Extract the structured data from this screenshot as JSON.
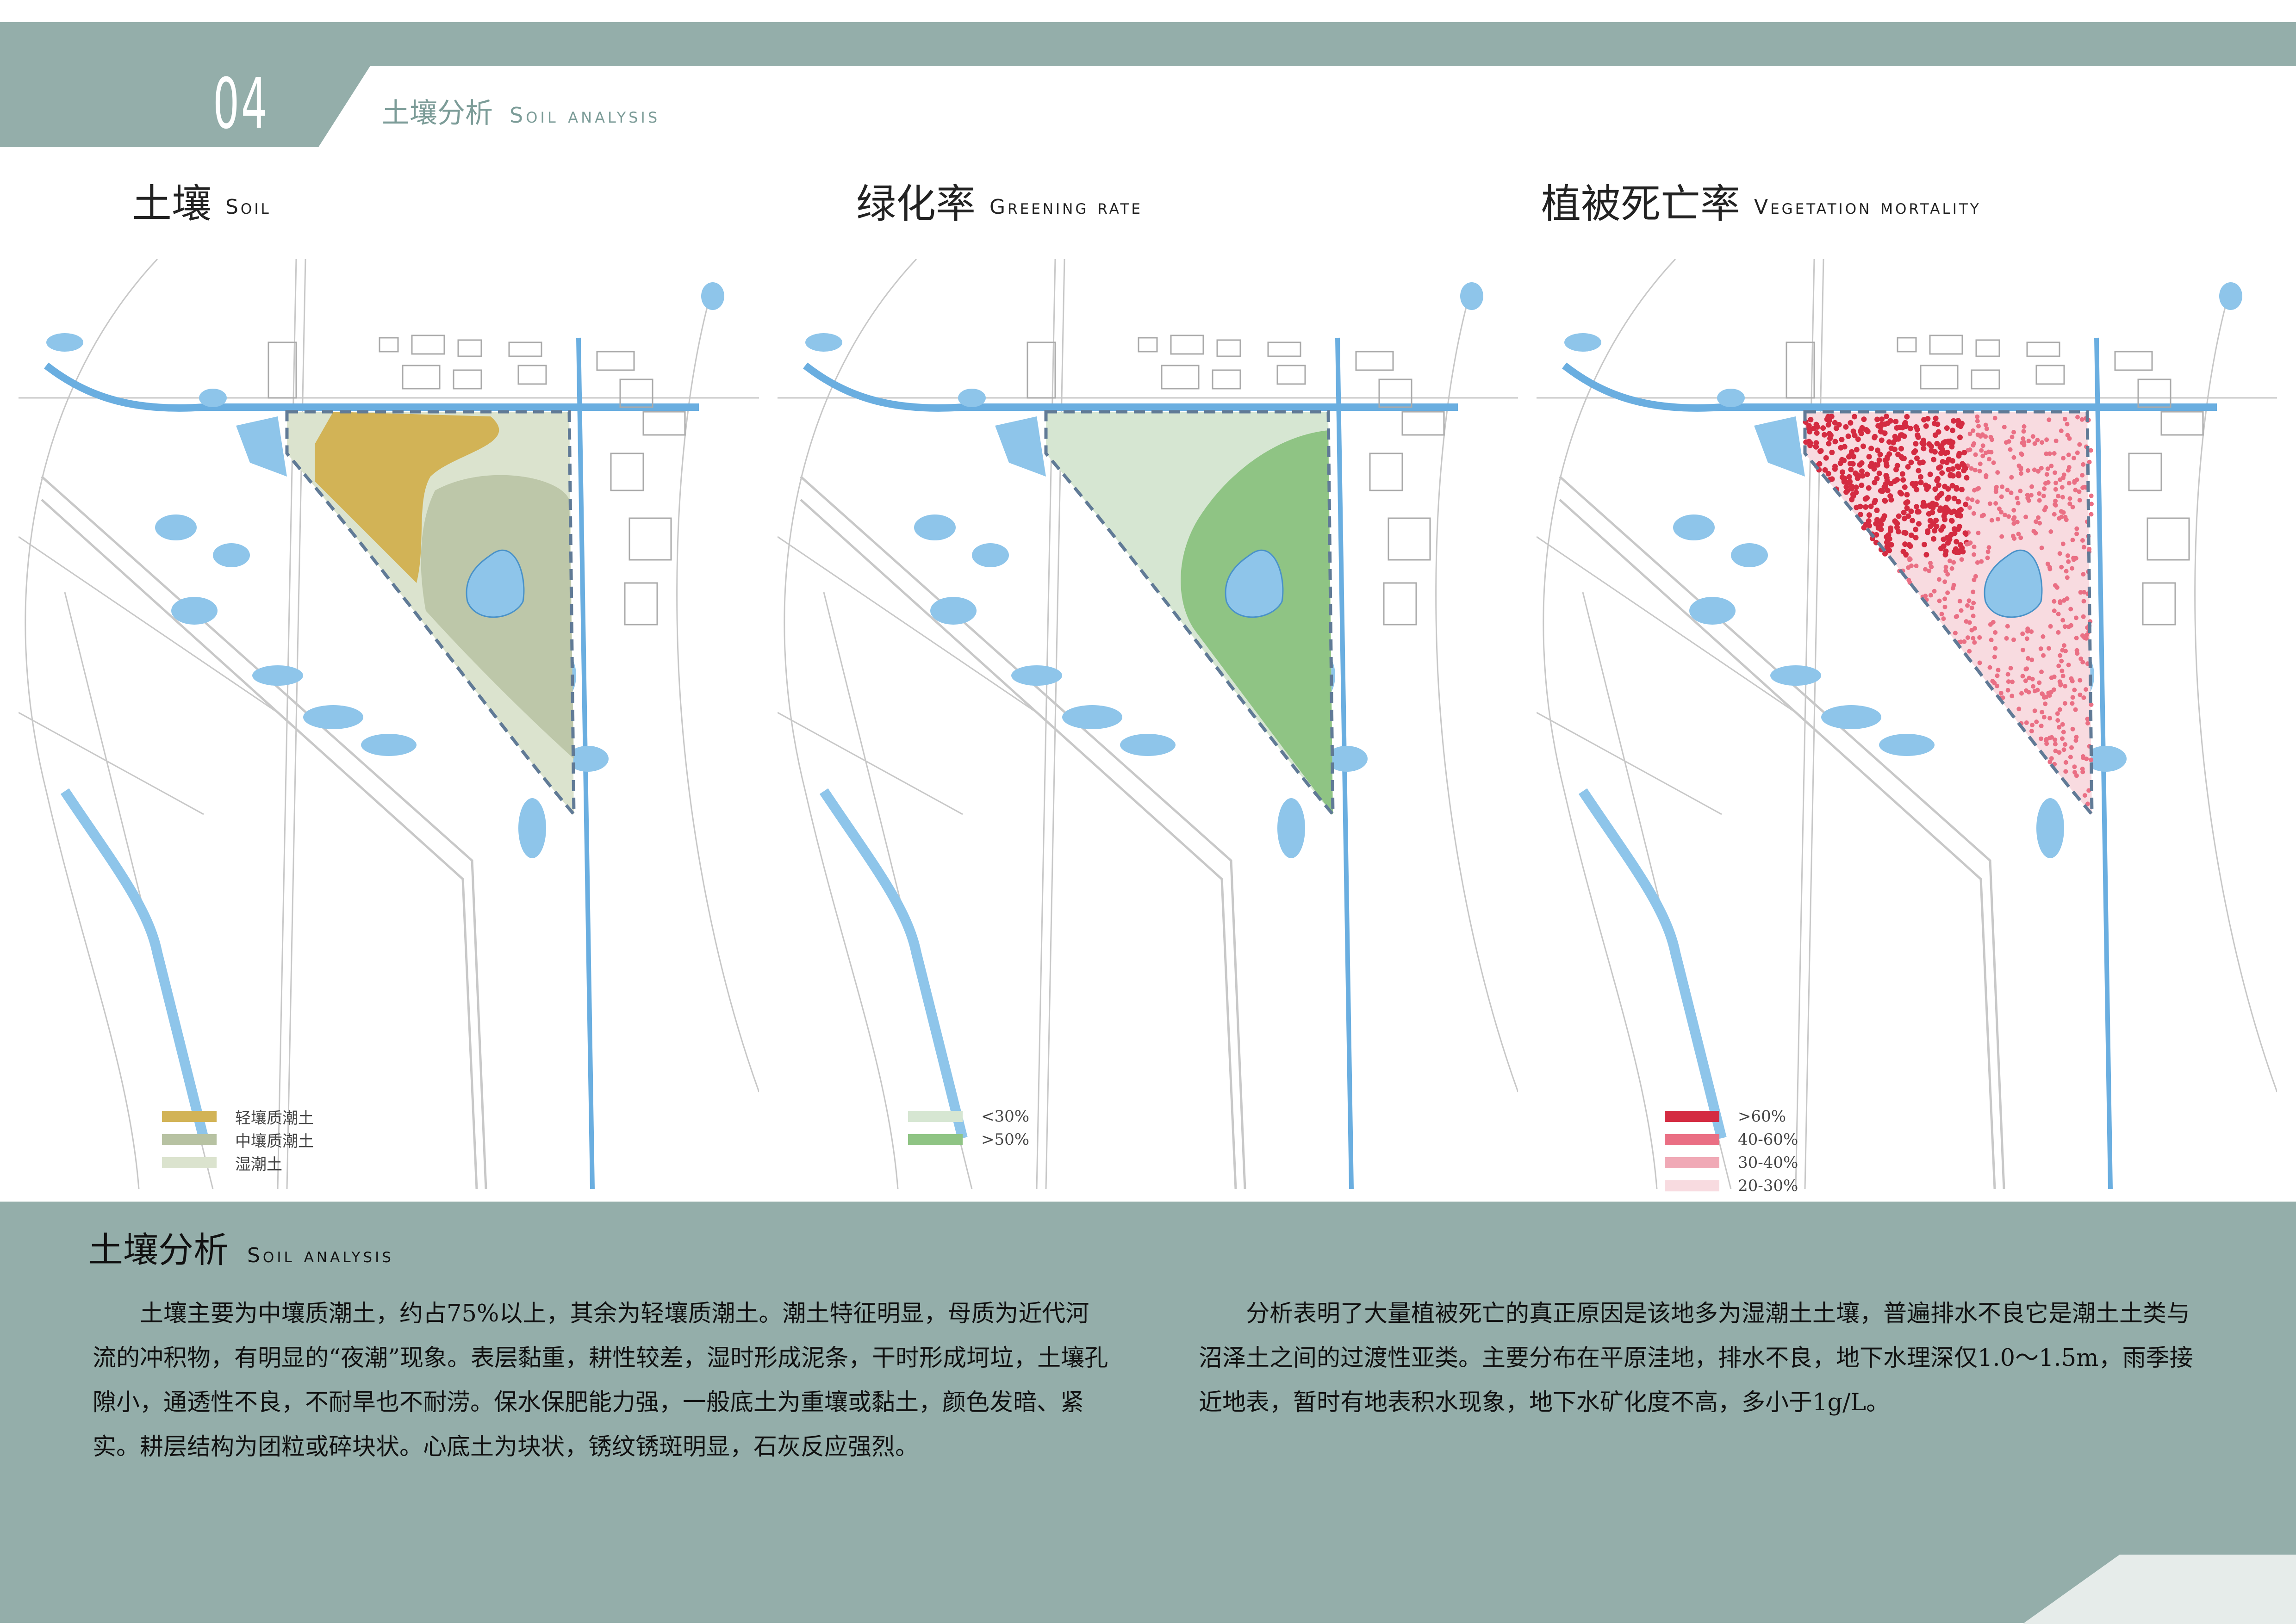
{
  "header": {
    "section_number": "04",
    "section_title_cn": "土壤分析",
    "section_title_en": "Soil analysis"
  },
  "maps": [
    {
      "title_cn": "土壤",
      "title_en": "Soil",
      "legend": [
        {
          "label": "轻壤质潮土",
          "color": "#d2b356"
        },
        {
          "label": "中壤质潮土",
          "color": "#b7c2a2"
        },
        {
          "label": "湿潮土",
          "color": "#dbe3ce"
        }
      ]
    },
    {
      "title_cn": "绿化率",
      "title_en": "Greening rate",
      "legend": [
        {
          "label": "<30%",
          "color": "#d6e6d2"
        },
        {
          "label": ">50%",
          "color": "#8fc484"
        }
      ]
    },
    {
      "title_cn": "植被死亡率",
      "title_en": "Vegetation mortality",
      "legend": [
        {
          "label": ">60%",
          "color": "#d42b41"
        },
        {
          "label": "40-60%",
          "color": "#ea6f84"
        },
        {
          "label": "30-40%",
          "color": "#f0a9b6"
        },
        {
          "label": "20-30%",
          "color": "#f8dbe0"
        }
      ]
    }
  ],
  "analysis": {
    "title_cn": "土壤分析",
    "title_en": "Soil analysis",
    "paragraph_left": "土壤主要为中壤质潮土，约占75%以上，其余为轻壤质潮土。潮土特征明显，母质为近代河流的冲积物，有明显的“夜潮”现象。表层黏重，耕性较差，湿时形成泥条，干时形成坷垃，土壤孔隙小，通透性不良，不耐旱也不耐涝。保水保肥能力强，一般底土为重壤或黏土，颜色发暗、紧实。耕层结构为团粒或碎块状。心底土为块状，锈纹锈斑明显，石灰反应强烈。",
    "paragraph_right": "分析表明了大量植被死亡的真正原因是该地多为湿潮土土壤，普遍排水不良它是潮土土类与沼泽土之间的过渡性亚类。主要分布在平原洼地，排水不良，地下水理深仅1.0～1.5m，雨季接近地表，暂时有地表积水现象，地下水矿化度不高，多小于1g/L。"
  },
  "colors": {
    "band": "#94aeaa",
    "water": "#8ec5ea",
    "canal": "#6aaee0",
    "road": "#c8c8c8",
    "site_border": "#607a96"
  }
}
